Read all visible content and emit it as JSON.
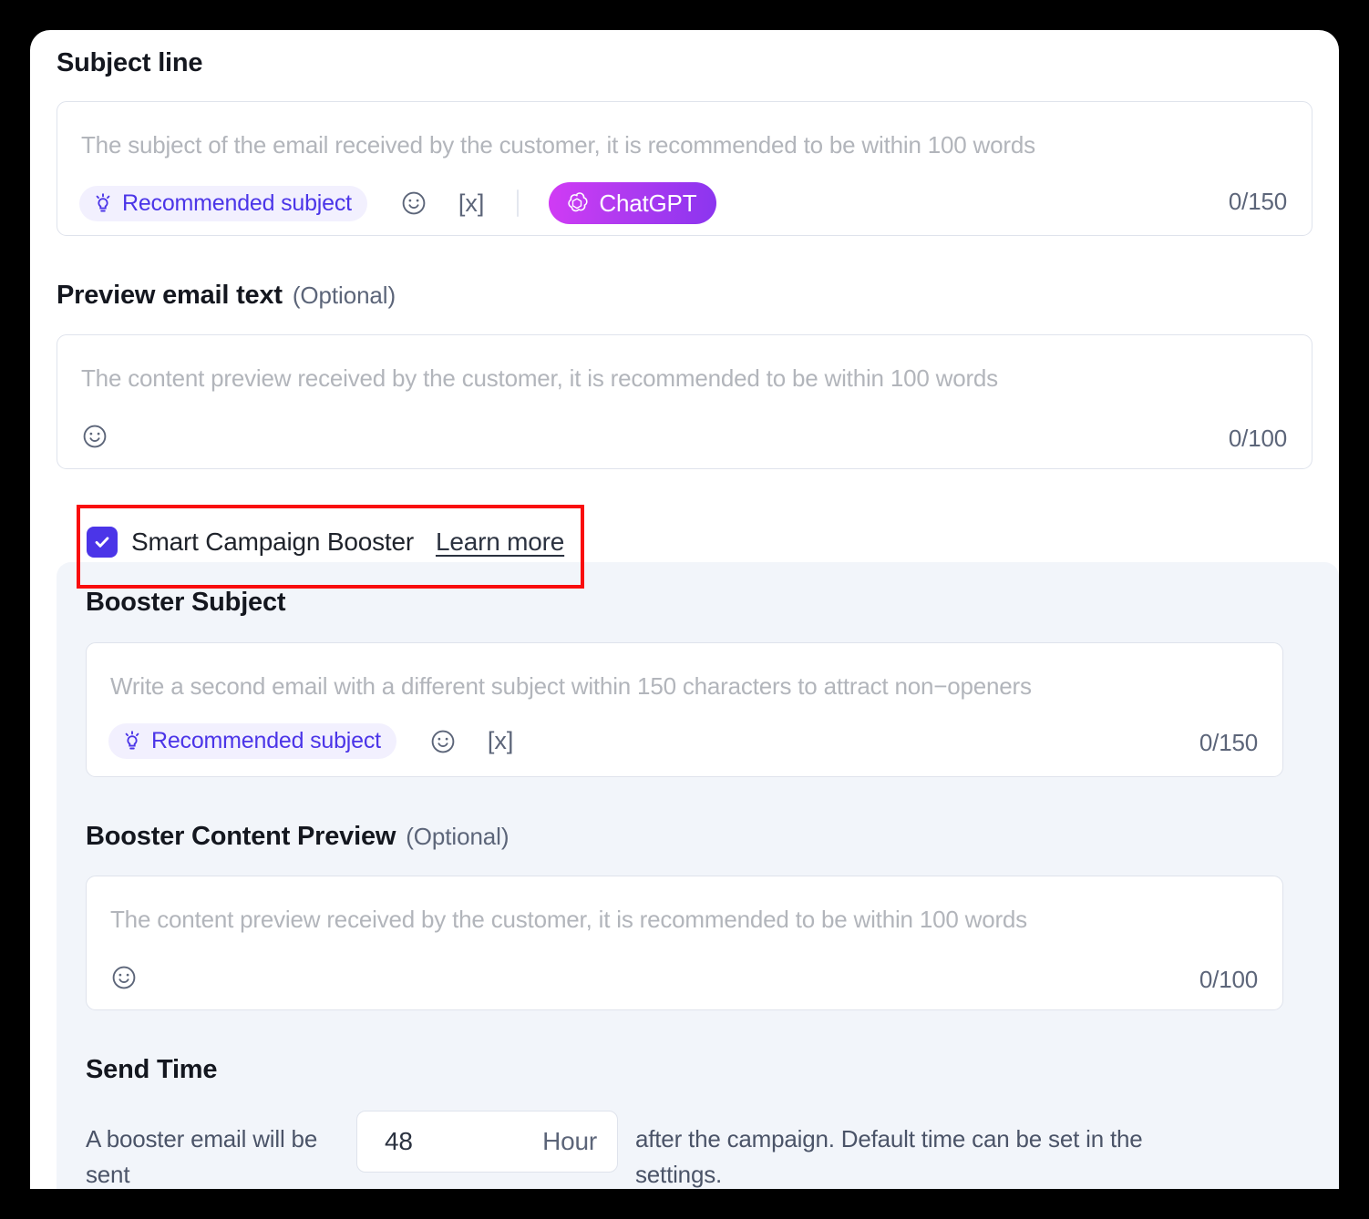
{
  "subject_section": {
    "heading": "Subject line",
    "placeholder": "The subject of the email received by the customer, it is recommended to be within 100 words",
    "value": "",
    "recommended_chip": "Recommended subject",
    "variable_token": "[x]",
    "chatgpt_label": "ChatGPT",
    "counter": "0/150",
    "icons": {
      "bulb": "lightbulb-icon",
      "emoji": "smiley-icon",
      "variable": "variable-token-icon",
      "chatgpt": "chatgpt-logo-icon"
    }
  },
  "preview_section": {
    "heading": "Preview email text",
    "optional": "(Optional)",
    "placeholder": "The content preview received by the customer, it is recommended to be within 100 words",
    "value": "",
    "counter": "0/100"
  },
  "booster_toggle": {
    "label": "Smart Campaign Booster",
    "link": "Learn more",
    "checked": true
  },
  "booster_subject": {
    "heading": "Booster Subject",
    "placeholder": "Write a second email with a different subject within 150 characters to attract non−openers",
    "value": "",
    "recommended_chip": "Recommended subject",
    "variable_token": "[x]",
    "counter": "0/150"
  },
  "booster_preview": {
    "heading": "Booster Content Preview",
    "optional": "(Optional)",
    "placeholder": "The content preview received by the customer, it is recommended to be within 100 words",
    "value": "",
    "counter": "0/100"
  },
  "send_time": {
    "heading": "Send Time",
    "text_before": "A booster email will be sent",
    "input_value": "48",
    "input_unit": "Hour",
    "text_after": "after the campaign. Default time can be set in the settings."
  },
  "colors": {
    "accent_purple": "#4b35e8",
    "chip_bg": "#f2f0fe",
    "chatgpt_gradient_start": "#d13bf5",
    "chatgpt_gradient_end": "#8b35ef",
    "highlight_red": "#f90d0d",
    "panel_bg": "#f2f5fa",
    "border": "#dfe3ec",
    "placeholder_text": "#b2b5bb",
    "muted_text": "#5c6579",
    "page_bg": "#000000"
  }
}
